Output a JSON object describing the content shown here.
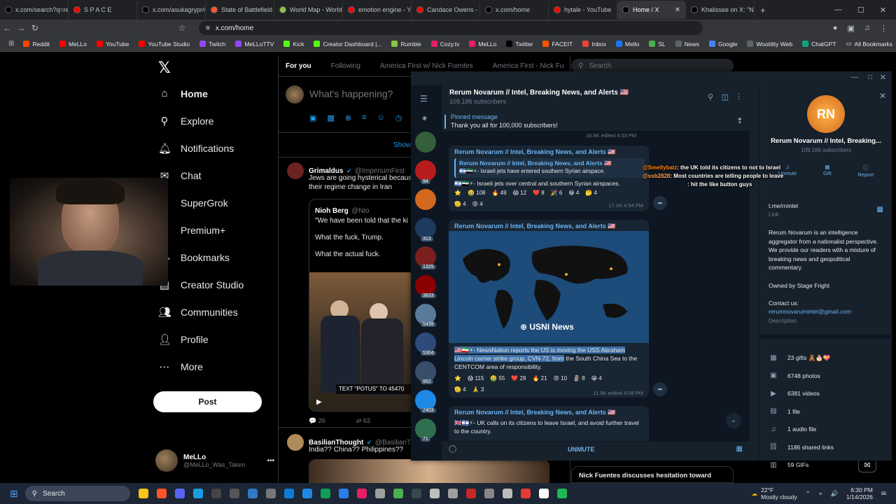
{
  "browser": {
    "tabs": [
      {
        "label": "x.com/search?q=re",
        "icon": "x-icon",
        "color": "#000000"
      },
      {
        "label": "S P A C E",
        "icon": "youtube-icon",
        "color": "#ff0000"
      },
      {
        "label": "x.com/asukagrypr/s",
        "icon": "x-icon",
        "color": "#000000"
      },
      {
        "label": "State of Battlefield",
        "icon": "brave-icon",
        "color": "#fb542b"
      },
      {
        "label": "World Map - World",
        "icon": "globe-icon",
        "color": "#8bc34a"
      },
      {
        "label": "emotion engine - Y",
        "icon": "youtube-icon",
        "color": "#ff0000"
      },
      {
        "label": "Candace Owens - Y",
        "icon": "youtube-icon",
        "color": "#ff0000"
      },
      {
        "label": "x.com/home",
        "icon": "x-icon",
        "color": "#000000"
      },
      {
        "label": "hytale - YouTube",
        "icon": "youtube-icon",
        "color": "#ff0000"
      },
      {
        "label": "Home / X",
        "icon": "x-icon",
        "color": "#000000",
        "active": true
      },
      {
        "label": "Khalissee on X: \"NE",
        "icon": "x-icon",
        "color": "#000000"
      }
    ],
    "url": "x.com/home",
    "bookmarks": [
      {
        "label": "Reddit",
        "color": "#ff4500"
      },
      {
        "label": "MeLLo",
        "color": "#ff0000"
      },
      {
        "label": "YouTube",
        "color": "#ff0000"
      },
      {
        "label": "YouTube Studio",
        "color": "#ff0000"
      },
      {
        "label": "Twitch",
        "color": "#9146ff"
      },
      {
        "label": "MeLLoTTV",
        "color": "#9146ff"
      },
      {
        "label": "Kick",
        "color": "#53fc18"
      },
      {
        "label": "Creator Dashboard |...",
        "color": "#53fc18"
      },
      {
        "label": "Rumble",
        "color": "#85c742"
      },
      {
        "label": "Cozy.tv",
        "color": "#e91e63"
      },
      {
        "label": "MeLLo",
        "color": "#e91e63"
      },
      {
        "label": "Twitter",
        "color": "#000000"
      },
      {
        "label": "FACEIT",
        "color": "#ff5500"
      },
      {
        "label": "Inbox",
        "color": "#ea4335"
      },
      {
        "label": "Mello",
        "color": "#1877f2"
      },
      {
        "label": "SL",
        "color": "#4caf50"
      },
      {
        "label": "News",
        "color": "#5f6368"
      },
      {
        "label": "Google",
        "color": "#4285f4"
      },
      {
        "label": "Wootility Web",
        "color": "#5f6368"
      },
      {
        "label": "ChatGPT",
        "color": "#10a37f"
      }
    ],
    "all_bookmarks": "All Bookmarks"
  },
  "xnav": {
    "items": [
      {
        "label": "Home",
        "icon": "home-icon"
      },
      {
        "label": "Explore",
        "icon": "search-icon"
      },
      {
        "label": "Notifications",
        "icon": "bell-icon"
      },
      {
        "label": "Chat",
        "icon": "chat-icon"
      },
      {
        "label": "SuperGrok",
        "icon": "grok-icon"
      },
      {
        "label": "Premium+",
        "icon": "x-icon"
      },
      {
        "label": "Bookmarks",
        "icon": "bookmark-icon"
      },
      {
        "label": "Creator Studio",
        "icon": "studio-icon"
      },
      {
        "label": "Communities",
        "icon": "communities-icon"
      },
      {
        "label": "Profile",
        "icon": "person-icon"
      },
      {
        "label": "More",
        "icon": "more-icon"
      }
    ],
    "post": "Post",
    "profile_name": "MeLLo",
    "profile_handle": "@MeLLo_Was_Taken"
  },
  "feed": {
    "tabs": [
      "For you",
      "Following",
      "America First w/ Nick Fuentes",
      "America First - Nick Fu"
    ],
    "search_placeholder": "Search",
    "compose_placeholder": "What's happening?",
    "show_more": "Show",
    "tweet1": {
      "name": "Grimaldus",
      "handle": "@ImperiumFirst",
      "text1": "Jews are going hysterical becaus",
      "text2": "their regime change in Iran",
      "quoted_name": "Nioh Berg",
      "quoted_handle": "@Nio",
      "quoted_line1": "\"We have been told that the ki",
      "quoted_line2": "What the fuck, Trump.",
      "quoted_line3": "What the actual fuck.",
      "video_caption": "TEXT \"POTUS\" TO 45470",
      "replies": "26",
      "retweets": "63"
    },
    "tweet2": {
      "name": "BasilianThought",
      "handle": "@BasilianT",
      "text": "India?? China?? Philippines??"
    },
    "trend": "Nick Fuentes discusses hesitation toward"
  },
  "telegram": {
    "channel": "Rerum Novarum // Intel, Breaking News, and Alerts 🇺🇸",
    "subscribers": "109,186 subscribers",
    "pinned_label": "Pinned message",
    "pinned_text": "Thank you all for 100,000 subscribers!",
    "strip_badges": [
      "94",
      "313",
      "1325",
      "3833",
      "5439",
      "5304",
      "952",
      "2403",
      "71"
    ],
    "msg0_meta": "16.6K  edited 4:53 PM",
    "msg1": {
      "sender": "Rerum Novarum // Intel, Breaking News, and Alerts 🇺🇸",
      "reply_sender": "Rerum Novarum // Intel, Breaking News, and Alerts 🇺🇸",
      "reply_text": "🇮🇱🇸🇾⚡- Israeli jets have entered southern Syrian airspace.",
      "text": "🇮🇱🇸🇾⚡- Israeli jets over central and southern Syrian airspaces.",
      "reacts": [
        "⭐",
        "🤮 108",
        "🔥 49",
        "😱 12",
        "❤️ 8",
        "🎉 6",
        "😁 4",
        "🤔 4",
        "🫡 4",
        "😡 4"
      ],
      "meta": "17.1K  4:54 PM"
    },
    "msg2": {
      "sender": "Rerum Novarum // Intel, Breaking News, and Alerts 🇺🇸",
      "map_logo": "⊕ USNI News",
      "text_a": "🇺🇸🇮🇷⚡- NewsNation reports the US is moving the USS Abraham",
      "text_b": "Lincoln carrier strike group, CVN-72, from",
      "text_c": " the South China Sea to the",
      "text_d": "CENTCOM area of responsibility.",
      "reacts": [
        "⭐",
        "😱 115",
        "🤮 55",
        "❤️ 29",
        "🔥 21",
        "😡 10",
        "🗿 8",
        "😁 4",
        "🫡 4",
        "🙏 3"
      ],
      "meta": "11.9K  edited 4:58 PM"
    },
    "msg3": {
      "sender": "Rerum Novarum // Intel, Breaking News, and Alerts 🇺🇸",
      "text": "🇬🇧🇮🇱⚡- UK calls on its citizens to leave Israel, and avoid further travel to the country."
    },
    "unmute": "UNMUTE",
    "info": {
      "name": "Rerum Novarum // Intel, Breaking...",
      "subs": "109,186 subscribers",
      "buttons": [
        "Unmute",
        "Gift",
        "Report"
      ],
      "link": "t.me/rnintel",
      "link_label": "Link",
      "desc1": "Rerum Novarum is an intelligence",
      "desc2": "aggregator from a nationalist perspective.",
      "desc3": "We provide our readers with a mixture of",
      "desc4": "breaking news and geopolitical",
      "desc5": "commentary.",
      "owned": "Owned by Stage Fright",
      "contact": "Contact us:",
      "email": "rerumnovarumintel@gmail.com",
      "desc_label": "Description",
      "stats": [
        "23 gifts 🧸🎂💝",
        "6748 photos",
        "6381 videos",
        "1 file",
        "1 audio file",
        "1186 shared links",
        "59 GIFs"
      ]
    }
  },
  "overlay_chat": [
    {
      "user": "@Smellybalz",
      "msg": ": the UK told its citizens to not to Israel",
      "color": "#ff8c1a"
    },
    {
      "user": "@ssb2828",
      "msg": ": Most countries are telling people to leave",
      "color": "#ffa64d"
    },
    {
      "user": "",
      "msg": ": hit the like button guys",
      "color": "#3f7cff"
    }
  ],
  "taskbar": {
    "search": "Search",
    "weather_temp": "22°F",
    "weather_desc": "Mostly cloudy",
    "time": "6:30 PM",
    "date": "1/14/2026"
  }
}
